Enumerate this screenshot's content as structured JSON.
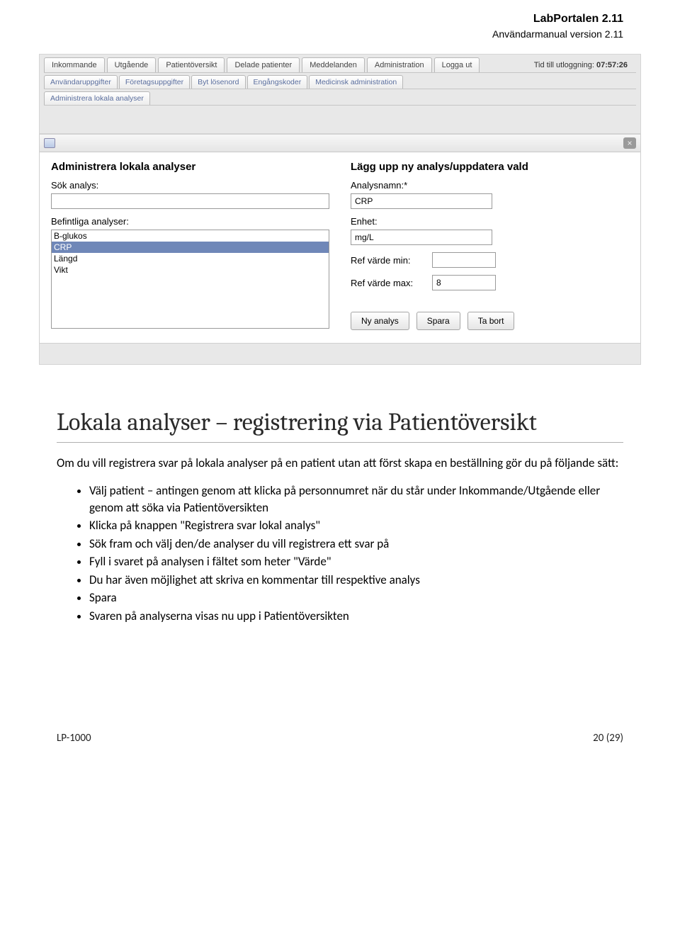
{
  "header": {
    "title": "LabPortalen 2.11",
    "subtitle": "Användarmanual version 2.11"
  },
  "ui": {
    "tabs": [
      "Inkommande",
      "Utgående",
      "Patientöversikt",
      "Delade patienter",
      "Meddelanden",
      "Administration",
      "Logga ut"
    ],
    "logout_prefix": "Tid till utloggning: ",
    "logout_time": "07:57:26",
    "subtabs": [
      "Användaruppgifter",
      "Företagsuppgifter",
      "Byt lösenord",
      "Engångskoder",
      "Medicinsk administration"
    ],
    "subtabs3": [
      "Administrera lokala analyser"
    ]
  },
  "dialog": {
    "close_glyph": "×",
    "left": {
      "heading": "Administrera lokala analyser",
      "search_label": "Sök analys:",
      "search_value": "",
      "existing_label": "Befintliga analyser:",
      "items": [
        "B-glukos",
        "CRP",
        "Längd",
        "Vikt"
      ],
      "selected_index": 1
    },
    "right": {
      "heading": "Lägg upp ny analys/uppdatera vald",
      "name_label": "Analysnamn:*",
      "name_value": "CRP",
      "unit_label": "Enhet:",
      "unit_value": "mg/L",
      "refmin_label": "Ref värde min:",
      "refmin_value": "",
      "refmax_label": "Ref värde max:",
      "refmax_value": "8",
      "buttons": [
        "Ny analys",
        "Spara",
        "Ta bort"
      ]
    }
  },
  "article": {
    "heading": "Lokala analyser – registrering via Patientöversikt",
    "intro": "Om du vill registrera svar på lokala analyser på en patient utan att först skapa en beställning gör du på följande sätt:",
    "bullets": [
      "Välj patient – antingen genom att klicka på personnumret när du står under Inkommande/Utgående eller genom att söka via Patientöversikten",
      "Klicka på knappen \"Registrera svar lokal analys\"",
      "Sök fram och välj den/de analyser du vill registrera ett svar på",
      "Fyll i svaret på analysen i fältet som heter \"Värde\"",
      "Du har även möjlighet att skriva en kommentar till respektive analys",
      "Spara",
      "Svaren på analyserna visas nu upp i Patientöversikten"
    ]
  },
  "footer": {
    "left": "LP-1000",
    "right": "20 (29)"
  }
}
